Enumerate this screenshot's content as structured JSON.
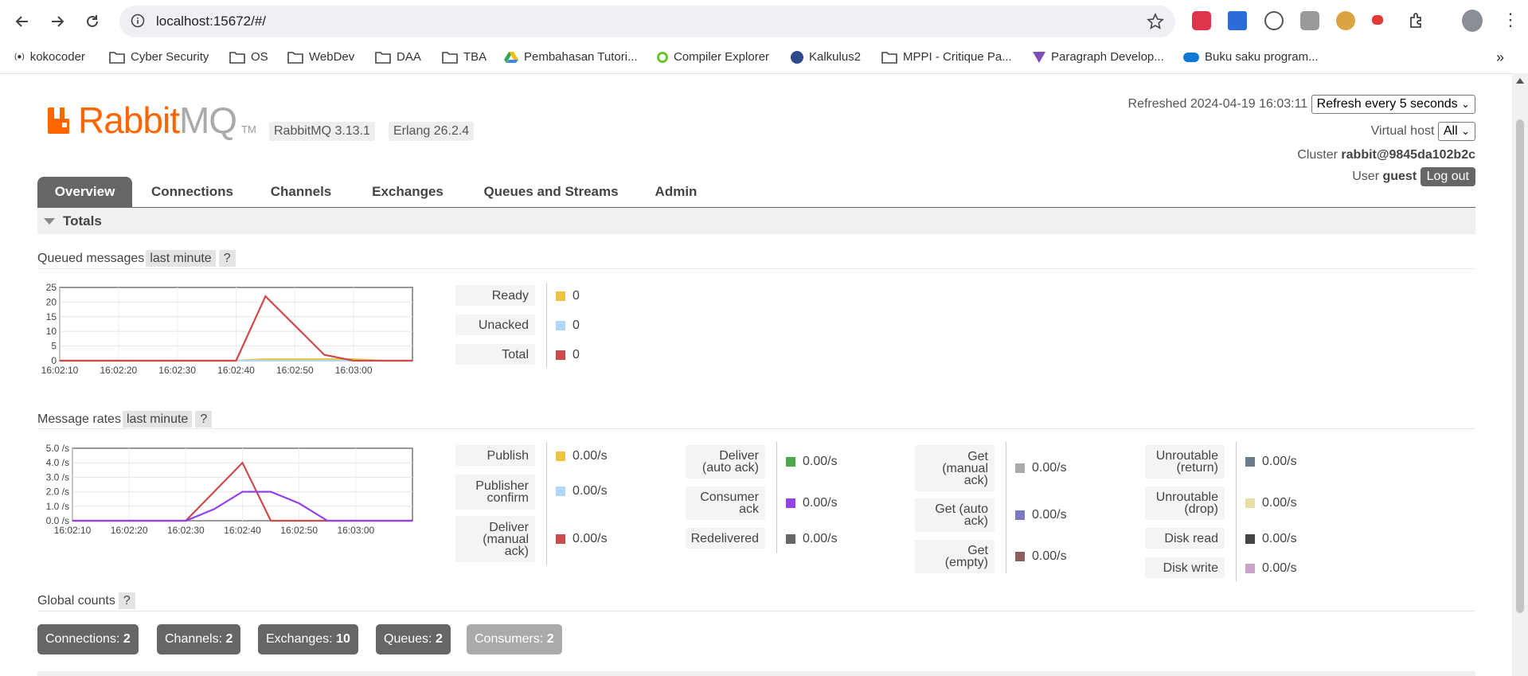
{
  "browser": {
    "url": "localhost:15672/#/",
    "bookmarks": [
      "kokocoder",
      "Cyber Security",
      "OS",
      "WebDev",
      "DAA",
      "TBA",
      "Pembahasan Tutori...",
      "Compiler Explorer",
      "Kalkulus2",
      "MPPI - Critique Pa...",
      "Paragraph Develop...",
      "Buku saku program..."
    ]
  },
  "header": {
    "logo_text": "Rabbit",
    "logo_mq": "MQ",
    "logo_tm": "TM",
    "version": "RabbitMQ 3.13.1",
    "erlang": "Erlang 26.2.4",
    "refreshed_label": "Refreshed",
    "refreshed_time": "2024-04-19 16:03:11",
    "refresh_select": "Refresh every 5 seconds",
    "vhost_label": "Virtual host",
    "vhost_value": "All",
    "cluster_label": "Cluster",
    "cluster_value": "rabbit@9845da102b2c",
    "user_label": "User",
    "user_value": "guest",
    "logout": "Log out"
  },
  "tabs": [
    "Overview",
    "Connections",
    "Channels",
    "Exchanges",
    "Queues and Streams",
    "Admin"
  ],
  "totals_title": "Totals",
  "queued": {
    "title": "Queued messages",
    "range": "last minute",
    "help": "?",
    "stats": [
      {
        "label": "Ready",
        "value": "0",
        "color": "#edc240"
      },
      {
        "label": "Unacked",
        "value": "0",
        "color": "#afd8f8"
      },
      {
        "label": "Total",
        "value": "0",
        "color": "#cb4b4b"
      }
    ]
  },
  "rates": {
    "title": "Message rates",
    "range": "last minute",
    "help": "?",
    "col1": [
      {
        "label": "Publish",
        "value": "0.00/s",
        "color": "#edc240"
      },
      {
        "label": "Publisher confirm",
        "value": "0.00/s",
        "color": "#afd8f8"
      },
      {
        "label": "Deliver (manual ack)",
        "value": "0.00/s",
        "color": "#cb4b4b"
      }
    ],
    "col2": [
      {
        "label": "Deliver (auto ack)",
        "value": "0.00/s",
        "color": "#4da74d"
      },
      {
        "label": "Consumer ack",
        "value": "0.00/s",
        "color": "#9440ed"
      },
      {
        "label": "Redelivered",
        "value": "0.00/s",
        "color": "#666666"
      }
    ],
    "col3": [
      {
        "label": "Get (manual ack)",
        "value": "0.00/s",
        "color": "#aaaaaa"
      },
      {
        "label": "Get (auto ack)",
        "value": "0.00/s",
        "color": "#7c79c3"
      },
      {
        "label": "Get (empty)",
        "value": "0.00/s",
        "color": "#8d6060"
      }
    ],
    "col4": [
      {
        "label": "Unroutable (return)",
        "value": "0.00/s",
        "color": "#6c7b8b"
      },
      {
        "label": "Unroutable (drop)",
        "value": "0.00/s",
        "color": "#e6e0a8"
      },
      {
        "label": "Disk read",
        "value": "0.00/s",
        "color": "#444444"
      },
      {
        "label": "Disk write",
        "value": "0.00/s",
        "color": "#c8a2c8"
      }
    ]
  },
  "global": {
    "title": "Global counts",
    "help": "?",
    "counts": [
      {
        "label": "Connections:",
        "value": "2"
      },
      {
        "label": "Channels:",
        "value": "2"
      },
      {
        "label": "Exchanges:",
        "value": "10"
      },
      {
        "label": "Queues:",
        "value": "2"
      },
      {
        "label": "Consumers:",
        "value": "2"
      }
    ]
  },
  "chart_data": [
    {
      "type": "line",
      "x": [
        "16:02:10",
        "16:02:15",
        "16:02:20",
        "16:02:25",
        "16:02:30",
        "16:02:35",
        "16:02:40",
        "16:02:45",
        "16:02:50",
        "16:02:55",
        "16:03:00",
        "16:03:05",
        "16:03:10"
      ],
      "xticks": [
        "16:02:10",
        "16:02:20",
        "16:02:30",
        "16:02:40",
        "16:02:50",
        "16:03:00"
      ],
      "yticks": [
        "0",
        "5",
        "10",
        "15",
        "20",
        "25"
      ],
      "ylim": [
        0,
        25
      ],
      "series": [
        {
          "name": "Ready",
          "color": "#edc240",
          "values": [
            0,
            0,
            0,
            0,
            0,
            0,
            0,
            0.5,
            0.5,
            0.5,
            0.5,
            0,
            0
          ]
        },
        {
          "name": "Unacked",
          "color": "#afd8f8",
          "values": [
            0,
            0,
            0,
            0,
            0,
            0,
            0,
            0,
            0,
            0,
            0,
            0,
            0
          ]
        },
        {
          "name": "Total",
          "color": "#cb4b4b",
          "values": [
            0,
            0,
            0,
            0,
            0,
            0,
            0,
            22,
            12,
            2,
            0,
            0,
            0
          ]
        }
      ]
    },
    {
      "type": "line",
      "x": [
        "16:02:10",
        "16:02:15",
        "16:02:20",
        "16:02:25",
        "16:02:30",
        "16:02:35",
        "16:02:40",
        "16:02:45",
        "16:02:50",
        "16:02:55",
        "16:03:00",
        "16:03:05",
        "16:03:10"
      ],
      "xticks": [
        "16:02:10",
        "16:02:20",
        "16:02:30",
        "16:02:40",
        "16:02:50",
        "16:03:00"
      ],
      "yticks": [
        "0.0 /s",
        "1.0 /s",
        "2.0 /s",
        "3.0 /s",
        "4.0 /s",
        "5.0 /s"
      ],
      "ylim": [
        0,
        5
      ],
      "series": [
        {
          "name": "Deliver (manual ack)",
          "color": "#cb4b4b",
          "values": [
            0,
            0,
            0,
            0,
            0,
            2,
            4,
            0,
            0,
            0,
            0,
            0,
            0
          ]
        },
        {
          "name": "Consumer ack",
          "color": "#9440ed",
          "values": [
            0,
            0,
            0,
            0,
            0,
            0.8,
            2,
            2,
            1.2,
            0,
            0,
            0,
            0
          ]
        }
      ]
    }
  ]
}
